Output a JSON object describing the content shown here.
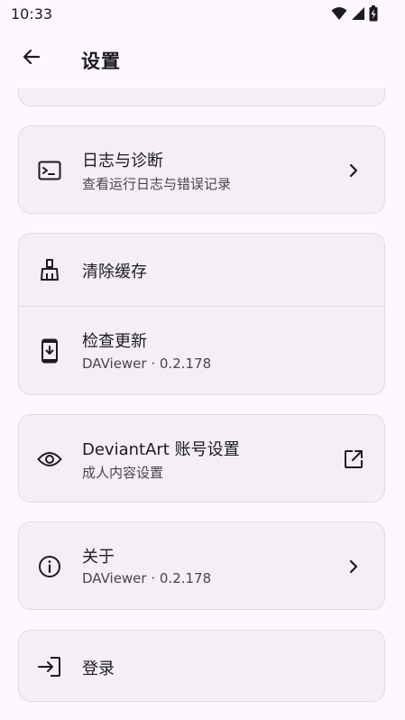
{
  "status_bar": {
    "time": "10:33"
  },
  "app_bar": {
    "title": "设置"
  },
  "settings": {
    "logs": {
      "title": "日志与诊断",
      "subtitle": "查看运行日志与错误记录"
    },
    "clear_cache": {
      "title": "清除缓存"
    },
    "check_update": {
      "title": "检查更新",
      "subtitle": "DAViewer · 0.2.178"
    },
    "deviantart": {
      "title": "DeviantArt 账号设置",
      "subtitle": "成人内容设置"
    },
    "about": {
      "title": "关于",
      "subtitle": "DAViewer · 0.2.178"
    },
    "login": {
      "title": "登录"
    }
  },
  "icons": {
    "back": "arrow-left-icon",
    "logs": "terminal-icon",
    "clear_cache": "broom-icon",
    "check_update": "phone-download-icon",
    "deviantart": "eye-icon",
    "deviantart_trail": "open-external-icon",
    "about": "info-icon",
    "login": "login-icon",
    "chevron": "chevron-right-icon"
  },
  "colors": {
    "background": "#fdf8fd",
    "card": "#f3eff4",
    "text": "#1c1b1f",
    "secondary_text": "#49454f"
  }
}
